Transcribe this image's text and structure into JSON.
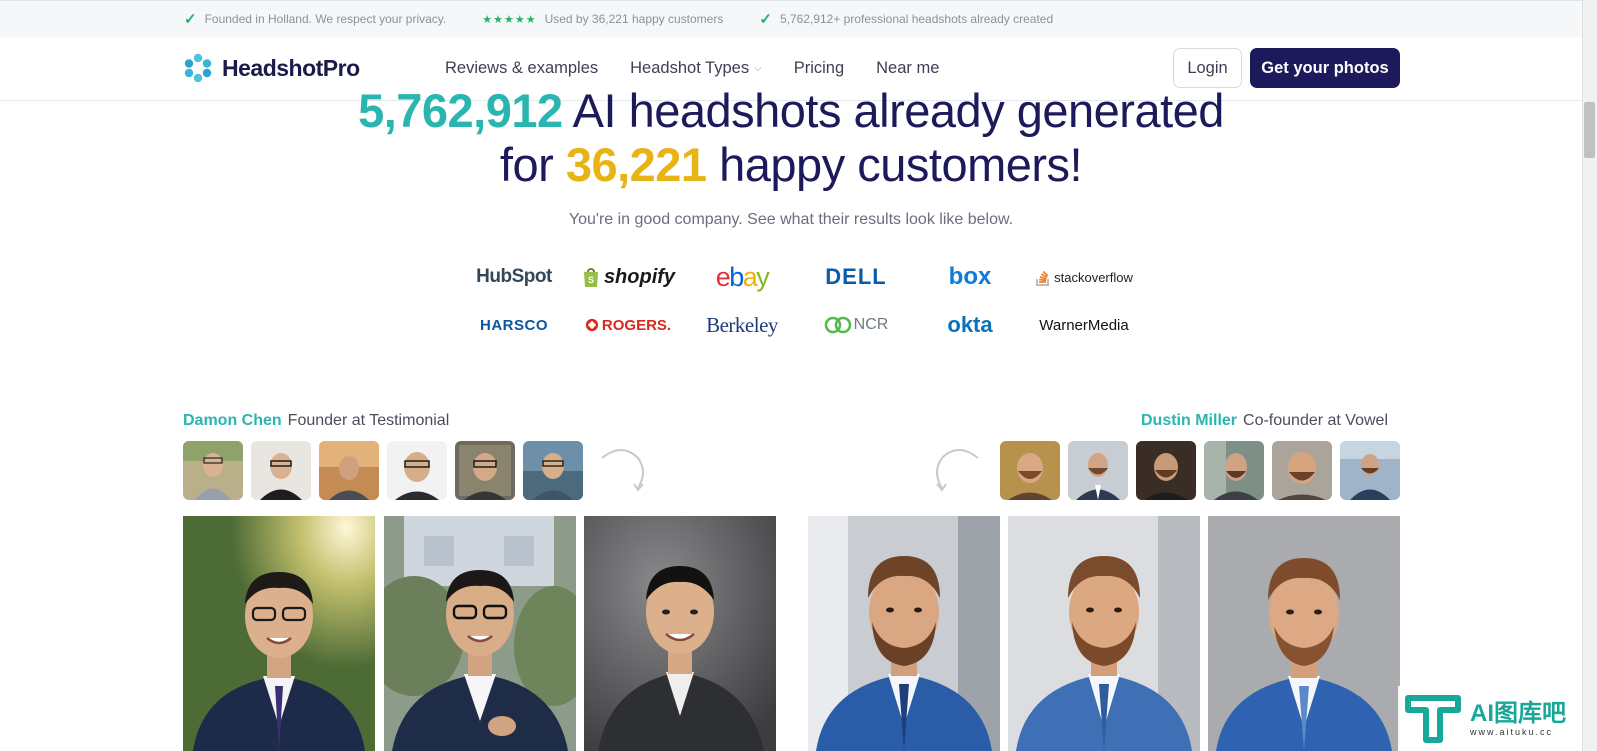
{
  "topbar": {
    "items": [
      "Founded in Holland. We respect your privacy.",
      "Used by 36,221 happy customers",
      "5,762,912+ professional headshots already created"
    ],
    "stars": "★★★★★"
  },
  "nav": {
    "brand": "HeadshotPro",
    "links": [
      "Reviews & examples",
      "Headshot Types",
      "Pricing",
      "Near me"
    ],
    "login": "Login",
    "cta": "Get your photos"
  },
  "hero": {
    "headshots_count": "5,762,912",
    "line1_rest": "AI headshots already generated",
    "for_word": "for",
    "customers_count": "36,221",
    "line2_rest": "happy customers!",
    "subtitle": "You're in good company. See what their results look like below."
  },
  "logos": [
    "HubSpot",
    "shopify",
    "ebay",
    "DELL",
    "box",
    "stackoverflow",
    "HARSCO",
    "ROGERS.",
    "Berkeley",
    "NCR",
    "okta",
    "WarnerMedia"
  ],
  "testimonials": [
    {
      "name": "Damon Chen",
      "role": "Founder at Testimonial"
    },
    {
      "name": "Dustin Miller",
      "role": "Co-founder at Vowel"
    }
  ],
  "watermark": {
    "title": "AI图库吧",
    "url": "www.aituku.cc"
  },
  "colors": {
    "navy": "#1d1a5b",
    "teal": "#2bb5b0",
    "gold": "#e7b416",
    "check_green": "#21b36b"
  }
}
